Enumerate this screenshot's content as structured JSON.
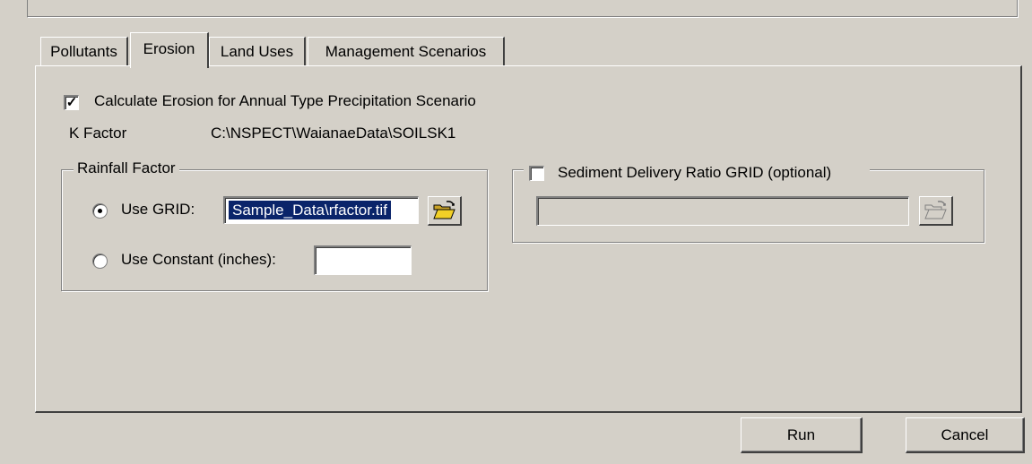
{
  "tabs": [
    {
      "label": "Pollutants",
      "active": false
    },
    {
      "label": "Erosion",
      "active": true
    },
    {
      "label": "Land Uses",
      "active": false
    },
    {
      "label": "Management Scenarios",
      "active": false
    }
  ],
  "erosion": {
    "calc_checkbox_label": "Calculate Erosion for Annual Type Precipitation Scenario",
    "calc_checked": true,
    "k_factor_label": "K Factor",
    "k_factor_value": "C:\\NSPECT\\WaianaeData\\SOILSK1",
    "rainfall": {
      "legend": "Rainfall Factor",
      "use_grid_label": "Use GRID:",
      "use_grid_selected": true,
      "grid_value": "Sample_Data\\rfactor.tif",
      "use_constant_label": "Use Constant (inches):",
      "constant_value": ""
    },
    "sdr": {
      "checkbox_label": "Sediment Delivery Ratio GRID (optional)",
      "checked": false,
      "value": ""
    }
  },
  "buttons": {
    "run": "Run",
    "cancel": "Cancel"
  },
  "icons": {
    "browse": "folder-open-icon",
    "checkmark": "checkmark-icon"
  },
  "colors": {
    "dialog_bg": "#d4d0c8",
    "selection_bg": "#0a246a",
    "folder_yellow": "#f2d027"
  }
}
